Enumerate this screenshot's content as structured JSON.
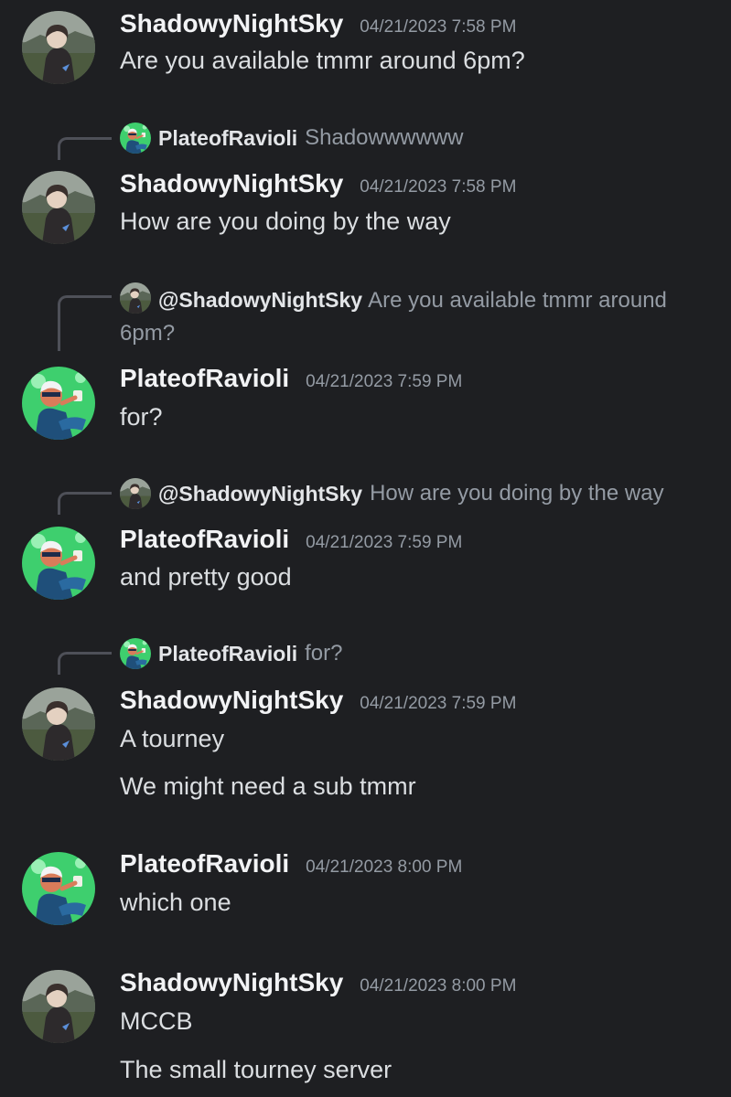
{
  "users": {
    "shadowy": "ShadowyNightSky",
    "ravioli": "PlateofRavioli",
    "shadowy_mention": "@ShadowyNightSky"
  },
  "messages": [
    {
      "author": "ShadowyNightSky",
      "timestamp": "04/21/2023 7:58 PM",
      "lines": [
        "Are you available tmmr around 6pm?"
      ]
    },
    {
      "reply_to": {
        "name": "PlateofRavioli",
        "text": "Shadowwwwww"
      },
      "author": "ShadowyNightSky",
      "timestamp": "04/21/2023 7:58 PM",
      "lines": [
        "How are you doing by the way"
      ]
    },
    {
      "reply_to": {
        "name": "@ShadowyNightSky",
        "text": "Are you available tmmr around 6pm?"
      },
      "author": "PlateofRavioli",
      "timestamp": "04/21/2023 7:59 PM",
      "lines": [
        "for?"
      ]
    },
    {
      "reply_to": {
        "name": "@ShadowyNightSky",
        "text": "How are you doing by the way"
      },
      "author": "PlateofRavioli",
      "timestamp": "04/21/2023 7:59 PM",
      "lines": [
        "and pretty good"
      ]
    },
    {
      "reply_to": {
        "name": "PlateofRavioli",
        "text": "for?"
      },
      "author": "ShadowyNightSky",
      "timestamp": "04/21/2023 7:59 PM",
      "lines": [
        "A tourney",
        "We might need a sub tmmr"
      ]
    },
    {
      "author": "PlateofRavioli",
      "timestamp": "04/21/2023 8:00 PM",
      "lines": [
        "which one"
      ]
    },
    {
      "author": "ShadowyNightSky",
      "timestamp": "04/21/2023 8:00 PM",
      "lines": [
        "MCCB",
        "The small tourney server"
      ]
    }
  ],
  "icons": {
    "shadowy_avatar": "landscape-portrait-avatar",
    "ravioli_avatar": "cartoon-character-avatar"
  },
  "colors": {
    "background": "#1e1f22",
    "username": "#f2f3f5",
    "timestamp": "#949ba4",
    "text": "#dbdee1",
    "reply_line": "#4e5058",
    "ravioli_green": "#3ecf6e"
  }
}
